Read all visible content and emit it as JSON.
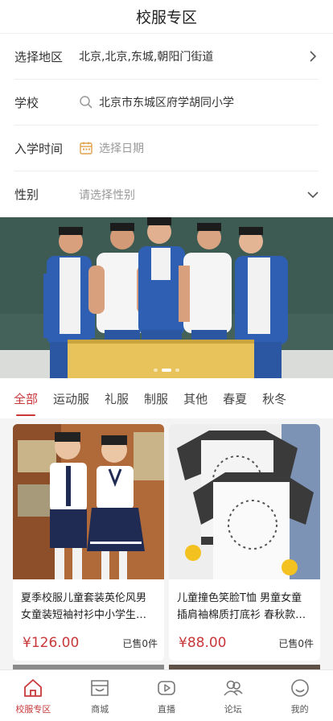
{
  "header": {
    "title": "校服专区"
  },
  "form": {
    "region": {
      "label": "选择地区",
      "value": "北京,北京,东城,朝阳门街道"
    },
    "school": {
      "label": "学校",
      "value": "北京市东城区府学胡同小学"
    },
    "enroll": {
      "label": "入学时间",
      "placeholder": "选择日期"
    },
    "gender": {
      "label": "性别",
      "placeholder": "请选择性别"
    }
  },
  "tabs": [
    "全部",
    "运动服",
    "礼服",
    "制服",
    "其他",
    "春夏",
    "秋冬"
  ],
  "products": [
    {
      "title": "夏季校服儿童套装英伦风男女童装短袖衬衫中小学生…",
      "price": "¥126.00",
      "sold": "已售0件"
    },
    {
      "title": "儿童撞色笑脸T恤 男童女童插肩袖棉质打底衫 春秋款…",
      "price": "¥88.00",
      "sold": "已售0件"
    }
  ],
  "nav": [
    {
      "label": "校服专区",
      "icon": "home-icon"
    },
    {
      "label": "商城",
      "icon": "mall-icon"
    },
    {
      "label": "直播",
      "icon": "live-icon"
    },
    {
      "label": "论坛",
      "icon": "forum-icon"
    },
    {
      "label": "我的",
      "icon": "profile-icon"
    }
  ],
  "colors": {
    "accent": "#c8373a",
    "uniform_blue": "#2f5fb3"
  }
}
